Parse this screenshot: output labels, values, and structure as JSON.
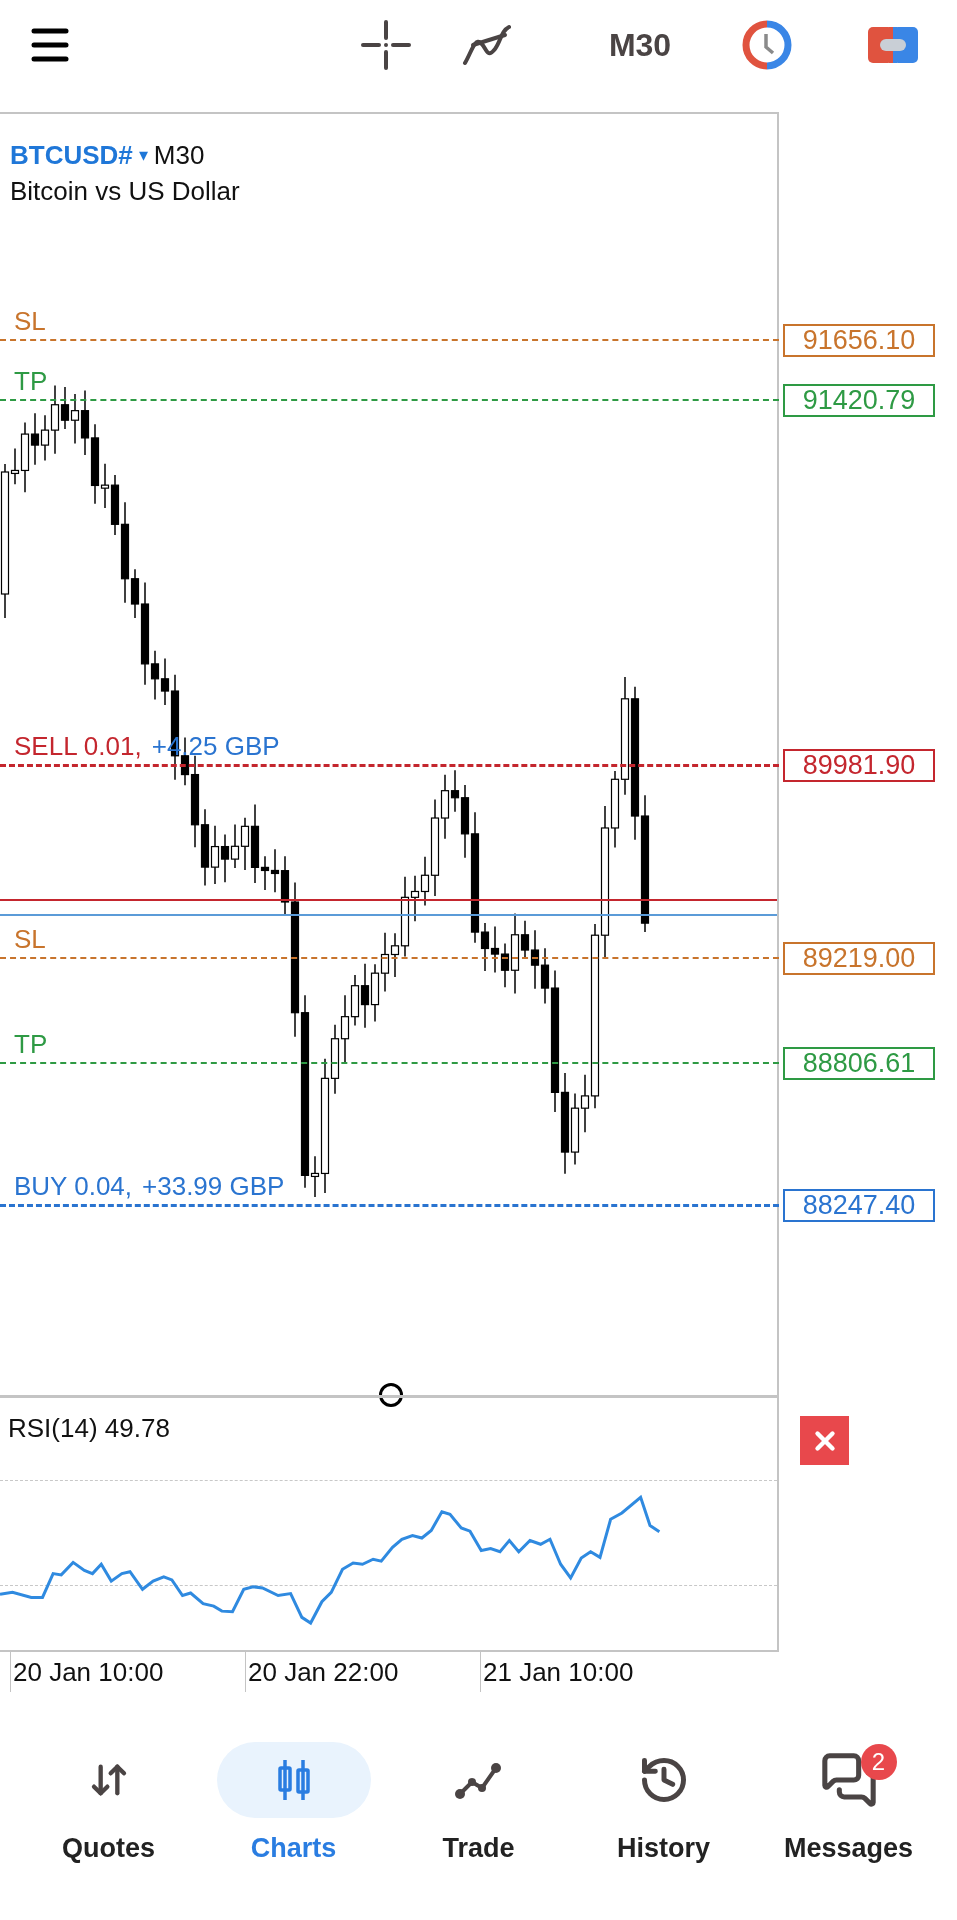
{
  "top_bar": {
    "timeframe": "M30"
  },
  "chart": {
    "symbol": "BTCUSD#",
    "caret": "▾",
    "timeframe": "M30",
    "description": "Bitcoin vs US Dollar",
    "order_lines": [
      {
        "kind": "sl",
        "label": "SL",
        "price": "91656.10",
        "color": "#c8742c"
      },
      {
        "kind": "tp",
        "label": "TP",
        "price": "91420.79",
        "color": "#2e9a44"
      },
      {
        "kind": "sell",
        "label": "SELL 0.01,",
        "profit": "+4.25 GBP",
        "price": "89981.90",
        "color": "#c4262e"
      },
      {
        "kind": "sl",
        "label": "SL",
        "price": "89219.00",
        "color": "#c8742c"
      },
      {
        "kind": "tp",
        "label": "TP",
        "price": "88806.61",
        "color": "#2e9a44"
      },
      {
        "kind": "buy",
        "label": "BUY 0.04,",
        "profit": "+33.99 GBP",
        "price": "88247.40",
        "color": "#2a74d0"
      }
    ],
    "indicator": {
      "label": "RSI(14) 49.78"
    },
    "time_labels": [
      "20 Jan 10:00",
      "20 Jan 22:00",
      "21 Jan 10:00"
    ]
  },
  "nav": [
    {
      "kind": "quotes",
      "label": "Quotes",
      "selected": false
    },
    {
      "kind": "charts",
      "label": "Charts",
      "selected": true
    },
    {
      "kind": "trade",
      "label": "Trade",
      "selected": false
    },
    {
      "kind": "history",
      "label": "History",
      "selected": false
    },
    {
      "kind": "messages",
      "label": "Messages",
      "selected": false,
      "badge": "2"
    }
  ]
}
